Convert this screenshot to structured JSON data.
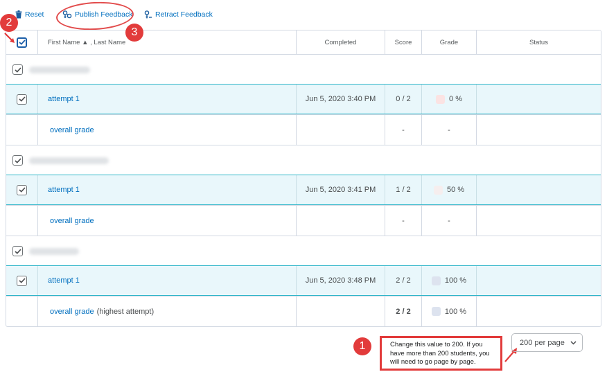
{
  "toolbar": {
    "reset_label": "Reset",
    "publish_label": "Publish Feedback",
    "retract_label": "Retract Feedback"
  },
  "table": {
    "headers": {
      "name": "First Name ▲ , Last Name",
      "completed": "Completed",
      "score": "Score",
      "grade": "Grade",
      "status": "Status"
    },
    "students": [
      {
        "attempt": {
          "label": "attempt 1",
          "completed": "Jun 5, 2020 3:40 PM",
          "score": "0 / 2",
          "grade": "0 %",
          "swatch_color": "#fbe3e3"
        },
        "overall": {
          "label": "overall grade",
          "suffix": "",
          "score": "-",
          "grade": "-"
        }
      },
      {
        "attempt": {
          "label": "attempt 1",
          "completed": "Jun 5, 2020 3:41 PM",
          "score": "1 / 2",
          "grade": "50 %",
          "swatch_color": "#f6eeee"
        },
        "overall": {
          "label": "overall grade",
          "suffix": "",
          "score": "-",
          "grade": "-"
        }
      },
      {
        "attempt": {
          "label": "attempt 1",
          "completed": "Jun 5, 2020 3:48 PM",
          "score": "2 / 2",
          "grade": "100 %",
          "swatch_color": "#dde3ef"
        },
        "overall": {
          "label": "overall grade",
          "suffix": "(highest attempt)",
          "score": "2 / 2",
          "grade": "100 %",
          "swatch_color": "#dde3ef"
        }
      }
    ]
  },
  "annotations": {
    "badge_1": "1",
    "badge_2": "2",
    "badge_3": "3",
    "note": "Change this value to 200.  If you have more than 200 students, you will need to go page by page.",
    "color": "#e23b3b"
  },
  "pagination": {
    "per_page": "200 per page"
  },
  "colors": {
    "link": "#006fbf",
    "selected_row_bg": "#e9f7fb",
    "selected_row_border": "#2fb6c9"
  }
}
